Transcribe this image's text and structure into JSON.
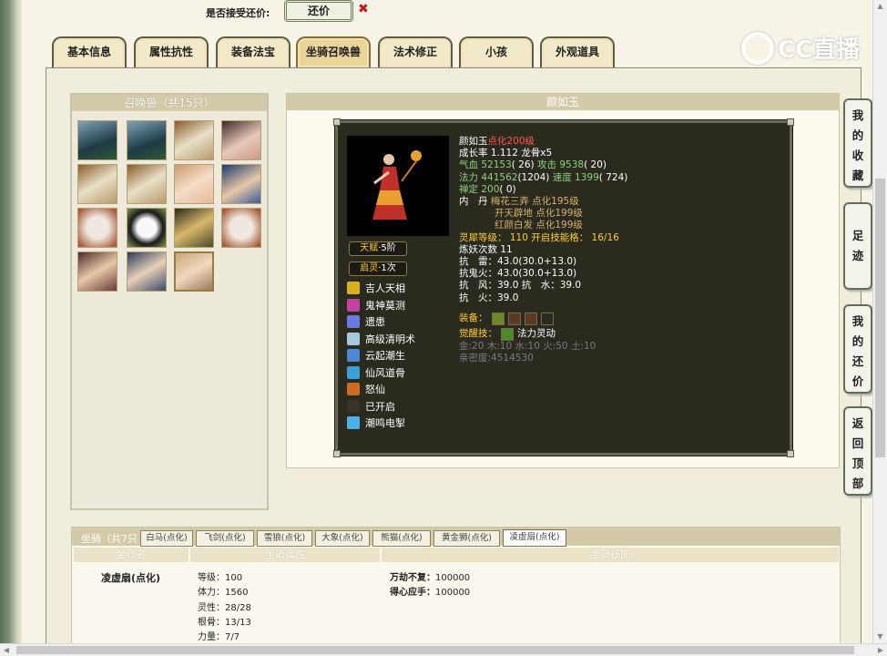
{
  "accept": {
    "label": "是否接受还价:",
    "button": "还价"
  },
  "logo": {
    "text": "CC直播"
  },
  "tabs": [
    "基本信息",
    "属性抗性",
    "装备法宝",
    "坐骑召唤兽",
    "法术修正",
    "小孩",
    "外观道具"
  ],
  "active_tab": 3,
  "summons": {
    "title": "召唤兽（共15只）"
  },
  "pet": {
    "name": "颜如玉",
    "l1_name": "颜如玉",
    "l1_level": "点化200级",
    "l2": "成长率 1.112 龙骨x5",
    "hp_label": "气血 ",
    "hp": "52153",
    "hp_extra": "( 26)",
    "atk_label": " 攻击 ",
    "atk": "9538",
    "atk_extra": "( 20)",
    "mp_label": "法力 ",
    "mp": "441562",
    "mp_extra": "(1204)",
    "spd_label": " 速度 ",
    "spd": "1399",
    "spd_extra": "( 724)",
    "ding_label": "禅定 ",
    "ding": "200",
    "ding_extra": "( 0)",
    "neidan_label": "内　丹",
    "neidan1": " 梅花三弄 点化195级",
    "neidan2": "开天辟地 点化199级",
    "neidan3": "红颜白发 点化199级",
    "lingxi": "灵犀等级： 110 开启技能格： 16/16",
    "lianyao": "炼妖次数 11",
    "res1": "抗　雷：43.0(30.0+13.0)",
    "res2": "抗鬼火：43.0(30.0+13.0)",
    "res3": "抗　风：39.0 抗　水：39.0",
    "res4": "抗　火：39.0",
    "equip_label": "装备：",
    "awaken_label": "觉醒技：",
    "awaken": "法力灵动",
    "elements": "金:20 木:10 水:10 火:50 土:10",
    "intimacy": "亲密度:4514530"
  },
  "badges": [
    {
      "label": "天赋",
      "value": "·5阶"
    },
    {
      "label": "启灵",
      "value": "·1次"
    }
  ],
  "skills": [
    {
      "name": "吉人天相",
      "icon": "lucky-icon",
      "color": "#d6b020"
    },
    {
      "name": "鬼神莫测",
      "icon": "ghost-icon",
      "color": "#c044a0"
    },
    {
      "name": "遗患",
      "icon": "legacy-icon",
      "color": "#6a7ae0"
    },
    {
      "name": "高级清明术",
      "icon": "clarity-icon",
      "color": "#a8c8e0"
    },
    {
      "name": "云起潮生",
      "icon": "cloud-icon",
      "color": "#4a88d8"
    },
    {
      "name": "仙风道骨",
      "icon": "immortal-icon",
      "color": "#3aa0d8"
    },
    {
      "name": "怒仙",
      "icon": "fury-icon",
      "color": "#d06a20"
    },
    {
      "name": "已开启",
      "icon": "unlocked-slot-icon",
      "color": "#3a3428"
    },
    {
      "name": "潮鸣电掣",
      "icon": "lightning-icon",
      "color": "#4ab0e8"
    }
  ],
  "mounts": {
    "title": "坐骑（共7只",
    "tabs": [
      "白马(点化)",
      "飞剑(点化)",
      "雪狼(点化)",
      "大象(点化)",
      "熊猫(点化)",
      "黄金狮(点化)",
      "凌虚扇(点化)"
    ],
    "active": 6,
    "col_name": "坐骑名",
    "col_attr": "坐骑属性",
    "col_skill": "坐骑技能",
    "name": "凌虚扇(点化)",
    "attrs": [
      "等级：100",
      "体力：1560",
      "灵性：28/28",
      "根骨：13/13",
      "力量：7/7"
    ],
    "skills": [
      {
        "name": "万劫不复：",
        "value": "100000"
      },
      {
        "name": "得心应手：",
        "value": "100000"
      }
    ]
  },
  "side_buttons": [
    [
      "我",
      "的",
      "收",
      "藏"
    ],
    [
      "足",
      "迹"
    ],
    [
      "我",
      "的",
      "还",
      "价"
    ],
    [
      "返",
      "回",
      "顶",
      "部"
    ]
  ]
}
